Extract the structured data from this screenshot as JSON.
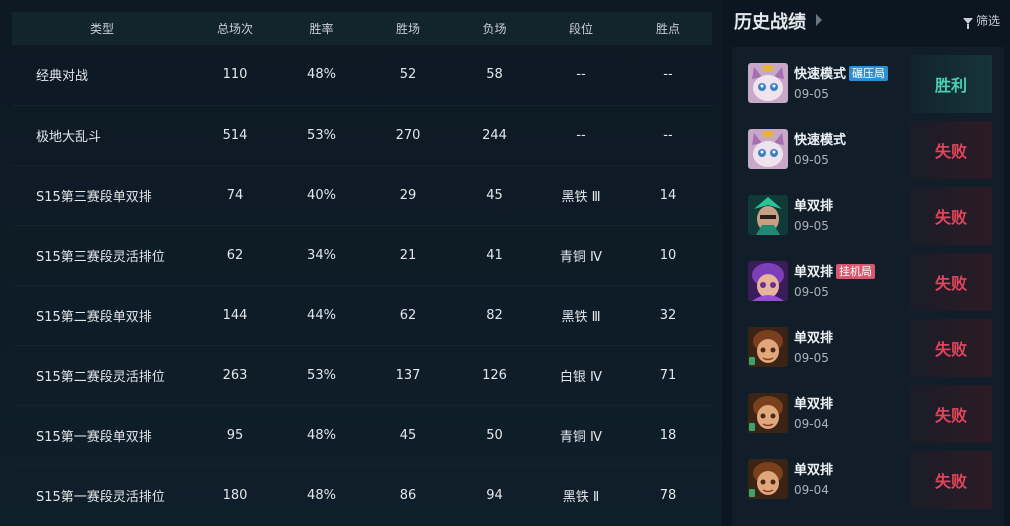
{
  "table": {
    "headers": [
      "类型",
      "总场次",
      "胜率",
      "胜场",
      "负场",
      "段位",
      "胜点"
    ],
    "rows": [
      {
        "type": "经典对战",
        "total": "110",
        "winrate": "48%",
        "wins": "52",
        "losses": "58",
        "rank": "--",
        "lp": "--"
      },
      {
        "type": "极地大乱斗",
        "total": "514",
        "winrate": "53%",
        "wins": "270",
        "losses": "244",
        "rank": "--",
        "lp": "--"
      },
      {
        "type": "S15第三赛段单双排",
        "total": "74",
        "winrate": "40%",
        "wins": "29",
        "losses": "45",
        "rank": "黑铁 Ⅲ",
        "lp": "14"
      },
      {
        "type": "S15第三赛段灵活排位",
        "total": "62",
        "winrate": "34%",
        "wins": "21",
        "losses": "41",
        "rank": "青铜 Ⅳ",
        "lp": "10"
      },
      {
        "type": "S15第二赛段单双排",
        "total": "144",
        "winrate": "44%",
        "wins": "62",
        "losses": "82",
        "rank": "黑铁 Ⅲ",
        "lp": "32"
      },
      {
        "type": "S15第二赛段灵活排位",
        "total": "263",
        "winrate": "53%",
        "wins": "137",
        "losses": "126",
        "rank": "白银 Ⅳ",
        "lp": "71"
      },
      {
        "type": "S15第一赛段单双排",
        "total": "95",
        "winrate": "48%",
        "wins": "45",
        "losses": "50",
        "rank": "青铜 Ⅳ",
        "lp": "18"
      },
      {
        "type": "S15第一赛段灵活排位",
        "total": "180",
        "winrate": "48%",
        "wins": "86",
        "losses": "94",
        "rank": "黑铁 Ⅱ",
        "lp": "78"
      }
    ]
  },
  "history": {
    "title": "历史战绩",
    "filter_label": "筛选",
    "matches": [
      {
        "mode": "快速模式",
        "tag": "碾压局",
        "tag_color": "#2c8fd6",
        "date": "09-05",
        "result": "胜利",
        "outcome": "win",
        "champion_icon": "cat-champion-avatar"
      },
      {
        "mode": "快速模式",
        "tag": "",
        "date": "09-05",
        "result": "失败",
        "outcome": "loss",
        "champion_icon": "cat-champion-avatar"
      },
      {
        "mode": "单双排",
        "tag": "",
        "date": "09-05",
        "result": "失败",
        "outcome": "loss",
        "champion_icon": "green-champion-avatar"
      },
      {
        "mode": "单双排",
        "tag": "挂机局",
        "tag_color": "#d9576e",
        "date": "09-05",
        "result": "失败",
        "outcome": "loss",
        "champion_icon": "purple-champion-avatar"
      },
      {
        "mode": "单双排",
        "tag": "",
        "date": "09-05",
        "result": "失败",
        "outcome": "loss",
        "champion_icon": "brown-champion-avatar"
      },
      {
        "mode": "单双排",
        "tag": "",
        "date": "09-04",
        "result": "失败",
        "outcome": "loss",
        "champion_icon": "brown-champion-avatar"
      },
      {
        "mode": "单双排",
        "tag": "",
        "date": "09-04",
        "result": "失败",
        "outcome": "loss",
        "champion_icon": "brown-champion-avatar"
      }
    ]
  },
  "colors": {
    "win": "#48d0b4",
    "loss": "#e0455d",
    "tag_blue": "#2c8fd6",
    "tag_red": "#d9576e"
  }
}
